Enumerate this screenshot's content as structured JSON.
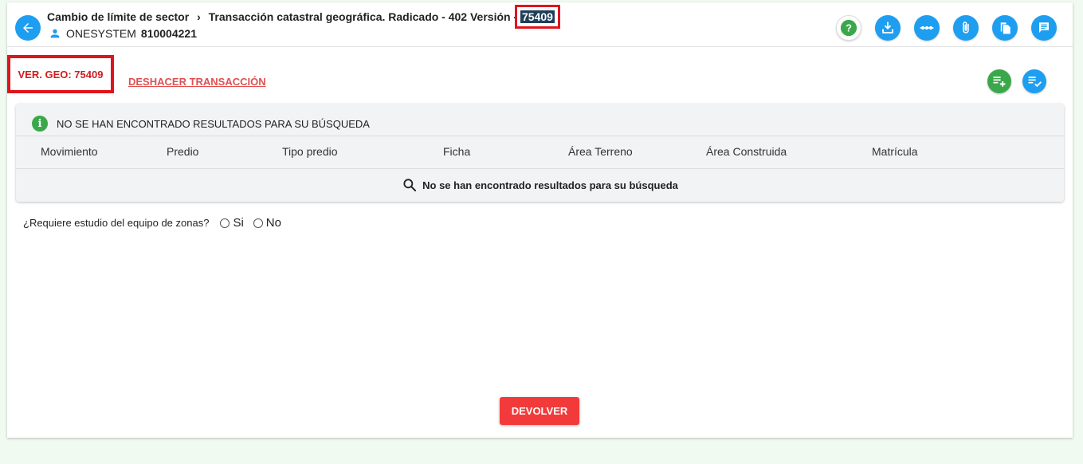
{
  "header": {
    "breadcrumb_1": "Cambio de límite de sector",
    "breadcrumb_2": "Transacción catastral geográfica. Radicado - 402 Versión -",
    "version_number": "75409",
    "user_name": "ONESYSTEM",
    "user_id": "810004221"
  },
  "toolbar_icons": [
    "help-icon",
    "download-icon",
    "more-options-icon",
    "attachment-icon",
    "copy-icon",
    "comment-icon"
  ],
  "vergeo_label": "VER. GEO: 75409",
  "undo_label": "DESHACER TRANSACCIÓN",
  "results": {
    "notice": "NO SE HAN ENCONTRADO RESULTADOS PARA SU BÚSQUEDA",
    "columns": [
      "Movimiento",
      "Predio",
      "Tipo predio",
      "Ficha",
      "Área Terreno",
      "Área Construida",
      "Matrícula"
    ],
    "empty_message": "No se han encontrado resultados para su búsqueda"
  },
  "question": {
    "label": "¿Requiere estudio del equipo de zonas?",
    "option_yes": "Si",
    "option_no": "No"
  },
  "devolver_label": "DEVOLVER",
  "colors": {
    "accent_blue": "#1e9ef0",
    "accent_green": "#3aa84a",
    "danger_red": "#f23a3a",
    "highlight_border": "#e0141d"
  }
}
